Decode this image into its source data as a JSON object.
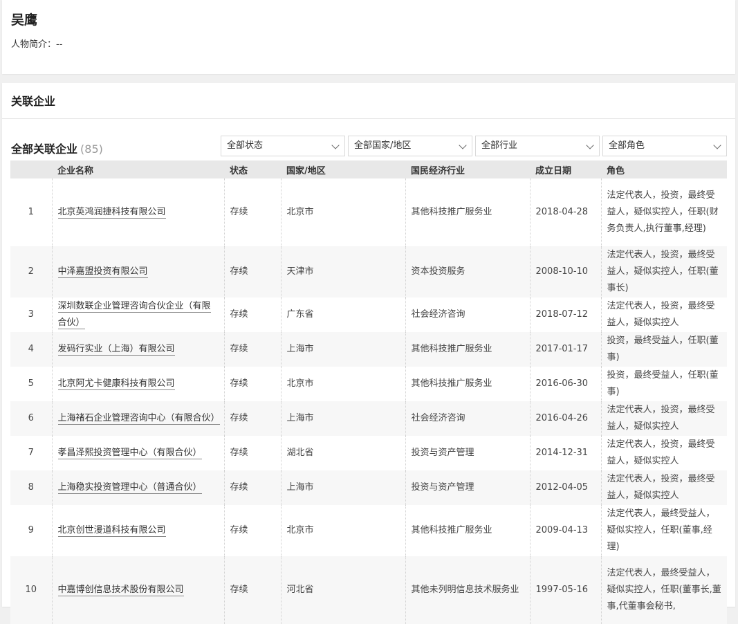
{
  "person": {
    "name": "吴鹰",
    "intro_label": "人物简介：",
    "intro_value": "--"
  },
  "section": {
    "title": "关联企业",
    "list_title": "全部关联企业",
    "count": "(85)"
  },
  "filters": [
    {
      "label": "全部状态",
      "icon": "chevron-down-icon"
    },
    {
      "label": "全部国家/地区",
      "icon": "chevron-down-icon"
    },
    {
      "label": "全部行业",
      "icon": "chevron-down-icon"
    },
    {
      "label": "全部角色",
      "icon": "chevron-down-icon"
    }
  ],
  "table": {
    "headers": [
      "",
      "企业名称",
      "状态",
      "国家/地区",
      "国民经济行业",
      "成立日期",
      "角色"
    ],
    "rows": [
      {
        "no": "1",
        "name": "北京英鸿润捷科技有限公司",
        "status": "存续",
        "region": "北京市",
        "industry": "其他科技推广服务业",
        "date": "2018-04-28",
        "role": "法定代表人，投资，最终受益人，疑似实控人，任职(财务负责人,执行董事,经理)"
      },
      {
        "no": "2",
        "name": "中泽嘉盟投资有限公司",
        "status": "存续",
        "region": "天津市",
        "industry": "资本投资服务",
        "date": "2008-10-10",
        "role": "法定代表人，投资，最终受益人，疑似实控人，任职(董事长)"
      },
      {
        "no": "3",
        "name": "深圳数联企业管理咨询合伙企业（有限合伙）",
        "status": "存续",
        "region": "广东省",
        "industry": "社会经济咨询",
        "date": "2018-07-12",
        "role": "法定代表人，投资，最终受益人，疑似实控人"
      },
      {
        "no": "4",
        "name": "发码行实业（上海）有限公司",
        "status": "存续",
        "region": "上海市",
        "industry": "其他科技推广服务业",
        "date": "2017-01-17",
        "role": "投资，最终受益人，任职(董事)"
      },
      {
        "no": "5",
        "name": "北京阿尤卡健康科技有限公司",
        "status": "存续",
        "region": "北京市",
        "industry": "其他科技推广服务业",
        "date": "2016-06-30",
        "role": "投资，最终受益人，任职(董事)"
      },
      {
        "no": "6",
        "name": "上海禇石企业管理咨询中心（有限合伙）",
        "status": "存续",
        "region": "上海市",
        "industry": "社会经济咨询",
        "date": "2016-04-26",
        "role": "法定代表人，投资，最终受益人，疑似实控人"
      },
      {
        "no": "7",
        "name": "孝昌泽熙投资管理中心（有限合伙）",
        "status": "存续",
        "region": "湖北省",
        "industry": "投资与资产管理",
        "date": "2014-12-31",
        "role": "法定代表人，投资，最终受益人，疑似实控人"
      },
      {
        "no": "8",
        "name": "上海稳实投资管理中心（普通合伙）",
        "status": "存续",
        "region": "上海市",
        "industry": "投资与资产管理",
        "date": "2012-04-05",
        "role": "法定代表人，投资，最终受益人，疑似实控人"
      },
      {
        "no": "9",
        "name": "北京创世漫道科技有限公司",
        "status": "存续",
        "region": "北京市",
        "industry": "其他科技推广服务业",
        "date": "2009-04-13",
        "role": "法定代表人，最终受益人，疑似实控人，任职(董事,经理)"
      },
      {
        "no": "10",
        "name": "中嘉博创信息技术股份有限公司",
        "status": "存续",
        "region": "河北省",
        "industry": "其他未列明信息技术服务业",
        "date": "1997-05-16",
        "role": "法定代表人，最终受益人，疑似实控人，任职(董事长,董事,代董事会秘书,"
      }
    ]
  }
}
